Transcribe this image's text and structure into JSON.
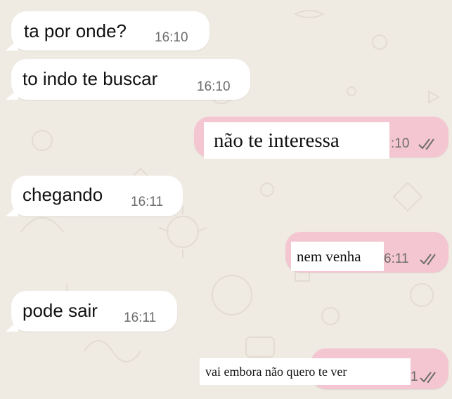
{
  "messages": [
    {
      "direction": "incoming",
      "text": "ta por onde?",
      "time": "16:10"
    },
    {
      "direction": "incoming",
      "text": "to indo te buscar",
      "time": "16:10"
    },
    {
      "direction": "outgoing",
      "overlay_text": "não te interessa",
      "time_partial": ":10",
      "status_icon": "double-check-icon"
    },
    {
      "direction": "incoming",
      "text": "chegando",
      "time": "16:11"
    },
    {
      "direction": "outgoing",
      "overlay_text": "nem venha",
      "time_partial": "6:11",
      "status_icon": "double-check-icon"
    },
    {
      "direction": "incoming",
      "text": "pode sair",
      "time": "16:11"
    },
    {
      "direction": "outgoing",
      "overlay_text": "vai embora não quero te ver",
      "time_partial": "1",
      "status_icon": "double-check-icon"
    }
  ],
  "colors": {
    "background": "#efeae2",
    "incoming_bubble": "#ffffff",
    "outgoing_bubble": "#f4c6d1",
    "tick": "#6d6d6d"
  }
}
